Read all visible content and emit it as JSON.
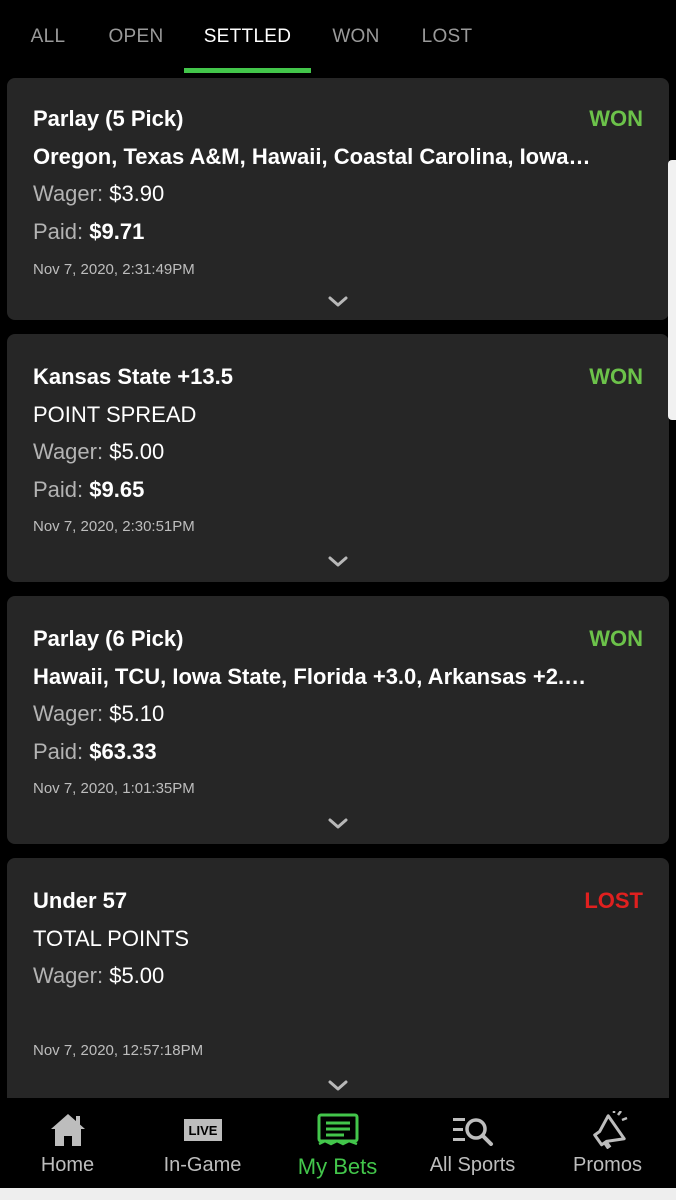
{
  "colors": {
    "accent": "#43c64b",
    "won": "#6cc24a",
    "lost": "#e0201f",
    "card": "#262626"
  },
  "tabs": [
    {
      "label": "ALL",
      "active": false
    },
    {
      "label": "OPEN",
      "active": false
    },
    {
      "label": "SETTLED",
      "active": true
    },
    {
      "label": "WON",
      "active": false
    },
    {
      "label": "LOST",
      "active": false
    }
  ],
  "bets": [
    {
      "title": "Parlay (5 Pick)",
      "status": "WON",
      "selection": "Oregon, Texas A&M, Hawaii, Coastal Carolina, Iowa S...",
      "wager_label": "Wager:",
      "wager": "$3.90",
      "paid_label": "Paid:",
      "paid": "$9.71",
      "date": "Nov 7, 2020, 2:31:49PM"
    },
    {
      "title": "Kansas State +13.5",
      "status": "WON",
      "selection": "POINT SPREAD",
      "wager_label": "Wager:",
      "wager": "$5.00",
      "paid_label": "Paid:",
      "paid": "$9.65",
      "date": "Nov 7, 2020, 2:30:51PM"
    },
    {
      "title": "Parlay (6 Pick)",
      "status": "WON",
      "selection": "Hawaii, TCU, Iowa State, Florida +3.0, Arkansas +2.0,...",
      "wager_label": "Wager:",
      "wager": "$5.10",
      "paid_label": "Paid:",
      "paid": "$63.33",
      "date": "Nov 7, 2020, 1:01:35PM"
    },
    {
      "title": "Under 57",
      "status": "LOST",
      "selection": "TOTAL POINTS",
      "wager_label": "Wager:",
      "wager": "$5.00",
      "date": "Nov 7, 2020, 12:57:18PM"
    }
  ],
  "bottom_nav": [
    {
      "label": "Home",
      "icon": "home-icon",
      "active": false
    },
    {
      "label": "In-Game",
      "icon": "live-icon",
      "badge": "LIVE",
      "active": false
    },
    {
      "label": "My Bets",
      "icon": "bet-slip-icon",
      "active": true
    },
    {
      "label": "All Sports",
      "icon": "sports-search-icon",
      "active": false
    },
    {
      "label": "Promos",
      "icon": "megaphone-icon",
      "active": false
    }
  ]
}
